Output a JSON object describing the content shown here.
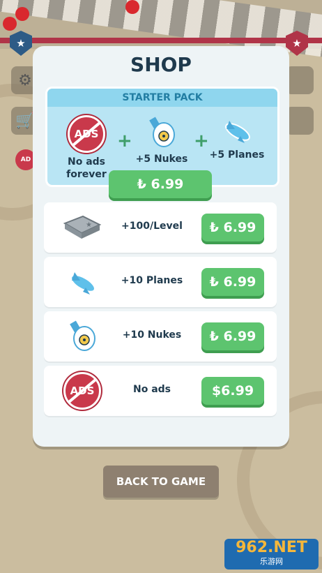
{
  "shop": {
    "title": "SHOP",
    "starter_pack": {
      "heading": "STARTER PACK",
      "items": [
        {
          "icon": "no-ads-icon",
          "icon_text": "ADS",
          "label": "No ads forever"
        },
        {
          "icon": "nuke-icon",
          "label": "+5 Nukes"
        },
        {
          "icon": "plane-icon",
          "label": "+5 Planes"
        }
      ],
      "price": "₺ 6.99"
    },
    "rows": [
      {
        "icon": "cash-stack-icon",
        "label": "+100/Level",
        "price": "₺ 6.99"
      },
      {
        "icon": "plane-icon",
        "label": "+10 Planes",
        "price": "₺ 6.99"
      },
      {
        "icon": "nuke-icon",
        "label": "+10 Nukes",
        "price": "₺ 6.99"
      },
      {
        "icon": "no-ads-icon",
        "icon_text": "ADS",
        "label": "No ads",
        "price": "$6.99"
      }
    ],
    "back_button": "BACK TO GAME"
  },
  "watermark": {
    "line1": "962.NET",
    "line2": "乐游网"
  },
  "colors": {
    "panel": "#eef4f6",
    "starter_bg": "#b9e5f4",
    "price_green": "#5dc46f",
    "title": "#1f3a4d",
    "back_button": "#8e8070"
  }
}
